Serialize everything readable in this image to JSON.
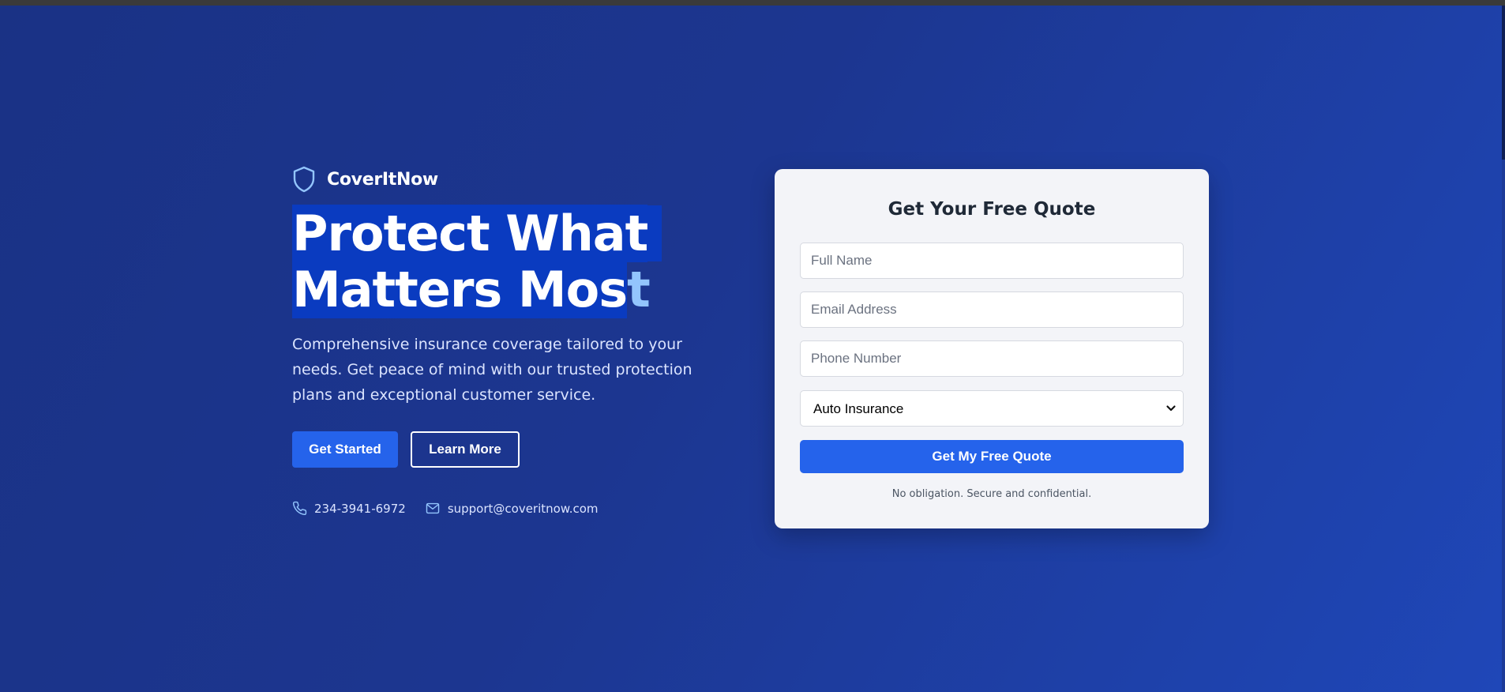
{
  "brand": {
    "name": "CoverItNow",
    "icon": "shield-icon"
  },
  "hero": {
    "headline_line1": "Protect What",
    "headline_line2_main": "Matters Mos",
    "headline_line2_tail": "t",
    "subtitle": "Comprehensive insurance coverage tailored to your needs. Get peace of mind with our trusted protection plans and exceptional customer service.",
    "primary_button": "Get Started",
    "secondary_button": "Learn More"
  },
  "contact": {
    "phone": "234-3941-6972",
    "phone_icon": "phone-icon",
    "email": "support@coveritnow.com",
    "email_icon": "mail-icon"
  },
  "quote_form": {
    "title": "Get Your Free Quote",
    "full_name_placeholder": "Full Name",
    "email_placeholder": "Email Address",
    "phone_placeholder": "Phone Number",
    "insurance_type_selected": "Auto Insurance",
    "submit_label": "Get My Free Quote",
    "note": "No obligation. Secure and confidential."
  },
  "colors": {
    "background": "#1e3a8a",
    "accent": "#2563eb",
    "card": "#f3f4f8",
    "highlight": "#0a3bc0",
    "light_accent": "#93c5fd"
  }
}
